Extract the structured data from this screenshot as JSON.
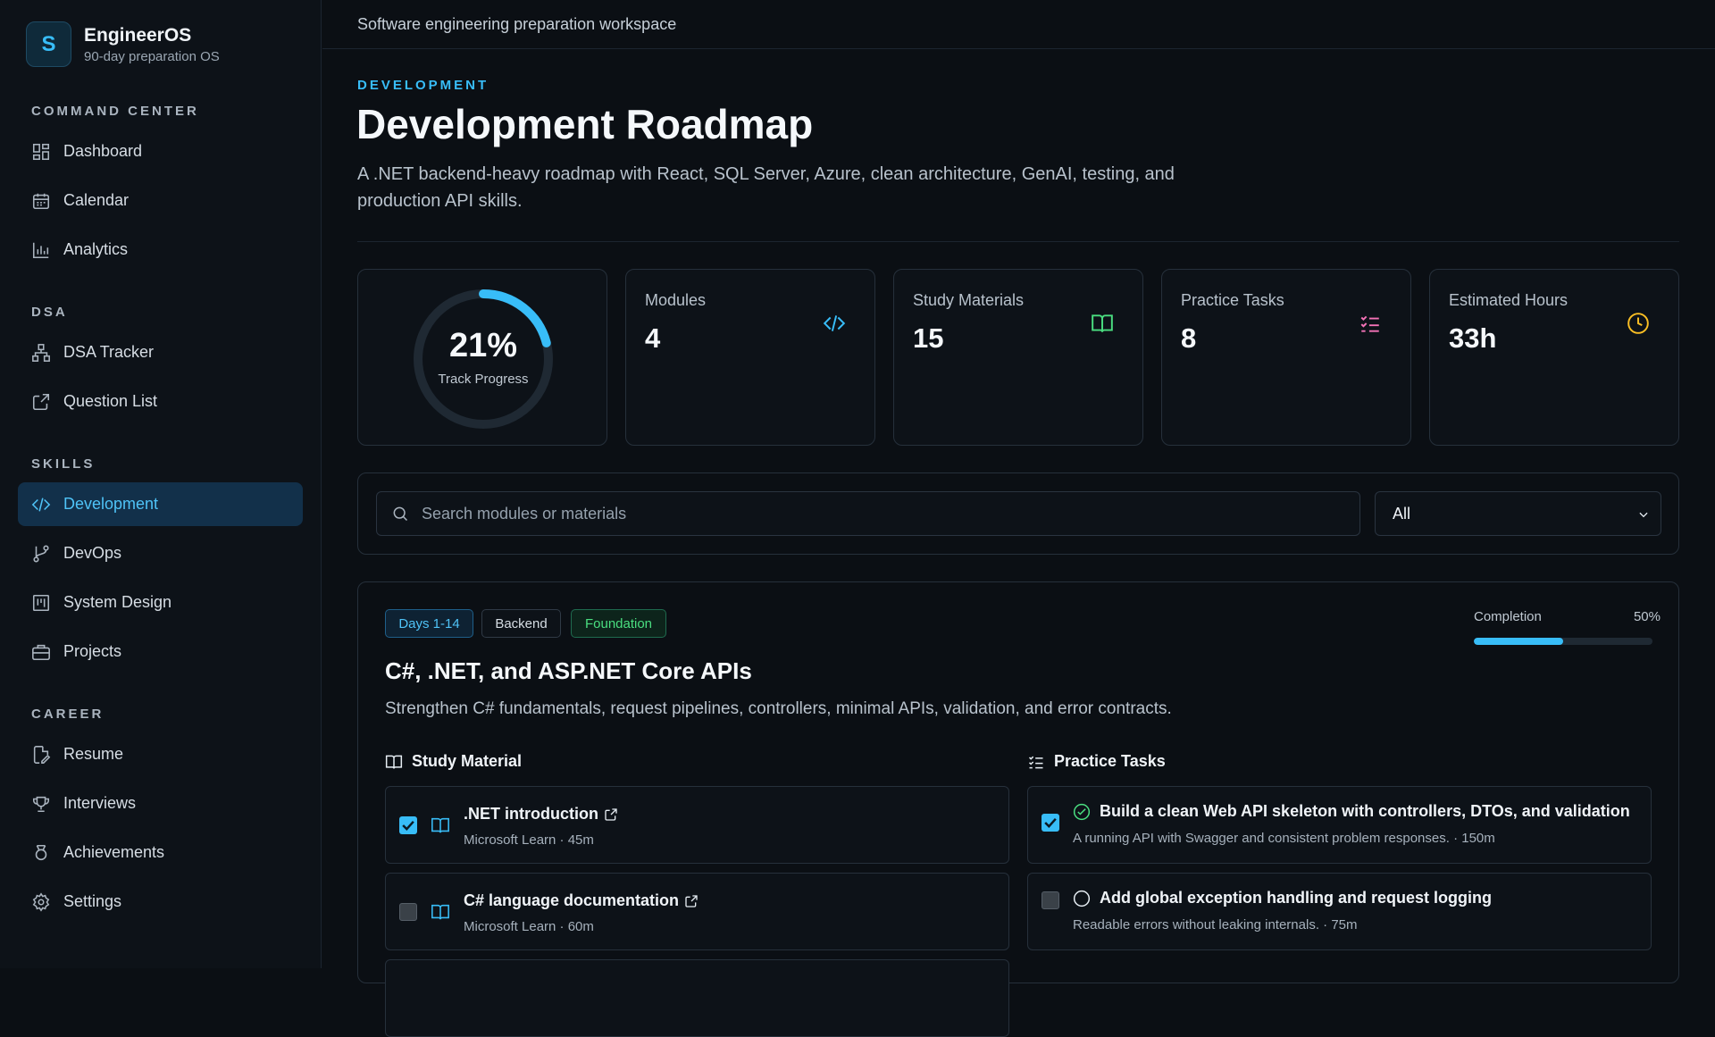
{
  "brand": {
    "logo_letter": "S",
    "title": "EngineerOS",
    "subtitle": "90-day preparation OS"
  },
  "sidebar": {
    "sections": [
      {
        "label": "COMMAND CENTER"
      },
      {
        "label": "DSA"
      },
      {
        "label": "SKILLS"
      },
      {
        "label": "CAREER"
      }
    ],
    "items": [
      {
        "label": "Dashboard",
        "icon": "grid-icon"
      },
      {
        "label": "Calendar",
        "icon": "calendar-icon"
      },
      {
        "label": "Analytics",
        "icon": "bar-chart-icon"
      },
      {
        "label": "DSA Tracker",
        "icon": "network-icon"
      },
      {
        "label": "Question List",
        "icon": "external-link-icon"
      },
      {
        "label": "Development",
        "icon": "code-icon",
        "active": true
      },
      {
        "label": "DevOps",
        "icon": "git-branch-icon"
      },
      {
        "label": "System Design",
        "icon": "layout-icon"
      },
      {
        "label": "Projects",
        "icon": "briefcase-icon"
      },
      {
        "label": "Resume",
        "icon": "file-edit-icon"
      },
      {
        "label": "Interviews",
        "icon": "trophy-icon"
      },
      {
        "label": "Achievements",
        "icon": "award-icon"
      },
      {
        "label": "Settings",
        "icon": "gear-icon"
      }
    ]
  },
  "topbar": {
    "text": "Software engineering preparation workspace"
  },
  "header": {
    "eyebrow": "DEVELOPMENT",
    "title": "Development Roadmap",
    "description": "A .NET backend-heavy roadmap with React, SQL Server, Azure, clean architecture, GenAI, testing, and production API skills."
  },
  "progress": {
    "value": 0.21,
    "value_label": "21%",
    "label": "Track Progress"
  },
  "stats": [
    {
      "label": "Modules",
      "value": "4",
      "icon": "code-icon",
      "color": "#38bdf8"
    },
    {
      "label": "Study Materials",
      "value": "15",
      "icon": "book-icon",
      "color": "#4ade80"
    },
    {
      "label": "Practice Tasks",
      "value": "8",
      "icon": "checklist-icon",
      "color": "#f472b6"
    },
    {
      "label": "Estimated Hours",
      "value": "33h",
      "icon": "clock-icon",
      "color": "#fbbf24"
    }
  ],
  "filters": {
    "search_placeholder": "Search modules or materials",
    "select_value": "All"
  },
  "module": {
    "tags": [
      "Days 1-14",
      "Backend",
      "Foundation"
    ],
    "title": "C#, .NET, and ASP.NET Core APIs",
    "description": "Strengthen C# fundamentals, request pipelines, controllers, minimal APIs, validation, and error contracts.",
    "completion_label": "Completion",
    "completion_value_label": "50%",
    "completion_value": 0.5,
    "study_heading": "Study Material",
    "tasks_heading": "Practice Tasks",
    "materials": [
      {
        "title": ".NET introduction",
        "meta": "Microsoft Learn · 45m",
        "checked": true
      },
      {
        "title": "C# language documentation",
        "meta": "Microsoft Learn · 60m",
        "checked": false
      }
    ],
    "tasks": [
      {
        "title": "Build a clean Web API skeleton with controllers, DTOs, and validation",
        "meta": "A running API with Swagger and consistent problem responses. · 150m",
        "checked": true
      },
      {
        "title": "Add global exception handling and request logging",
        "meta": "Readable errors without leaking internals. · 75m",
        "checked": false
      }
    ]
  }
}
